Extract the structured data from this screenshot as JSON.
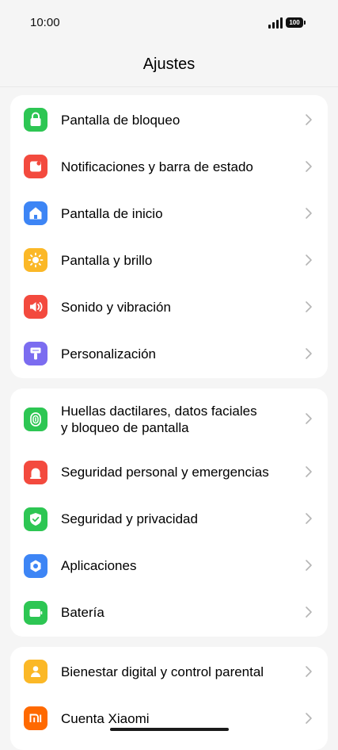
{
  "status_bar": {
    "time": "10:00",
    "battery": "100"
  },
  "header": {
    "title": "Ajustes"
  },
  "groups": [
    {
      "items": [
        {
          "label": "Pantalla de bloqueo",
          "icon": "lock-icon",
          "color": "#2dc653"
        },
        {
          "label": "Notificaciones y barra de estado",
          "icon": "notification-icon",
          "color": "#f34a3e"
        },
        {
          "label": "Pantalla de inicio",
          "icon": "home-icon",
          "color": "#3d85f5"
        },
        {
          "label": "Pantalla y brillo",
          "icon": "sun-icon",
          "color": "#fbb827"
        },
        {
          "label": "Sonido y vibración",
          "icon": "speaker-icon",
          "color": "#f34a3e"
        },
        {
          "label": "Personalización",
          "icon": "brush-icon",
          "color": "#7b6cf0"
        }
      ]
    },
    {
      "items": [
        {
          "label_line1": "Huellas dactilares, datos faciales",
          "label_line2": "y bloqueo de pantalla",
          "icon": "fingerprint-icon",
          "color": "#2dc653"
        },
        {
          "label": "Seguridad personal y emergencias",
          "icon": "siren-icon",
          "color": "#f34a3e"
        },
        {
          "label": "Seguridad y privacidad",
          "icon": "shield-icon",
          "color": "#2dc653"
        },
        {
          "label": "Aplicaciones",
          "icon": "apps-icon",
          "color": "#3d85f5"
        },
        {
          "label": "Batería",
          "icon": "battery-icon",
          "color": "#2dc653"
        }
      ]
    },
    {
      "items": [
        {
          "label": "Bienestar digital y control parental",
          "icon": "wellbeing-icon",
          "color": "#fbb827"
        },
        {
          "label": "Cuenta Xiaomi",
          "icon": "xiaomi-icon",
          "color": "#ff6900"
        }
      ]
    }
  ]
}
